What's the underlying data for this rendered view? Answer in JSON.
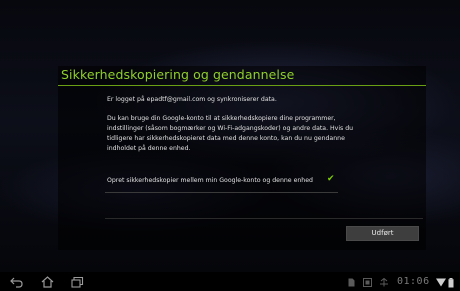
{
  "dialog": {
    "title": "Sikkerhedskopiering og gendannelse",
    "intro": "Er logget på epadtf@gmail.com og synkroniserer data.",
    "description": "Du kan bruge din Google-konto til at sikkerhedskopiere dine programmer, indstillinger (såsom bogmærker og Wi-Fi-adgangskoder) og andre data. Hvis du tidligere har sikkerhedskopieret data med denne konto, kan du nu gendanne indholdet på denne enhed.",
    "option_label": "Opret sikkerhedskopier mellem min Google-konto og denne enhed",
    "option_checked": true,
    "done_label": "Udført"
  },
  "statusbar": {
    "nav_icons": [
      "back-icon",
      "home-icon",
      "recent-apps-icon"
    ],
    "status_icons": [
      "file-icon",
      "screenshot-icon",
      "usb-icon",
      "wifi-icon",
      "battery-icon"
    ],
    "clock": "01:06"
  },
  "colors": {
    "accent": "#8fd12a",
    "check": "#7fd000",
    "background": "#05060a"
  }
}
